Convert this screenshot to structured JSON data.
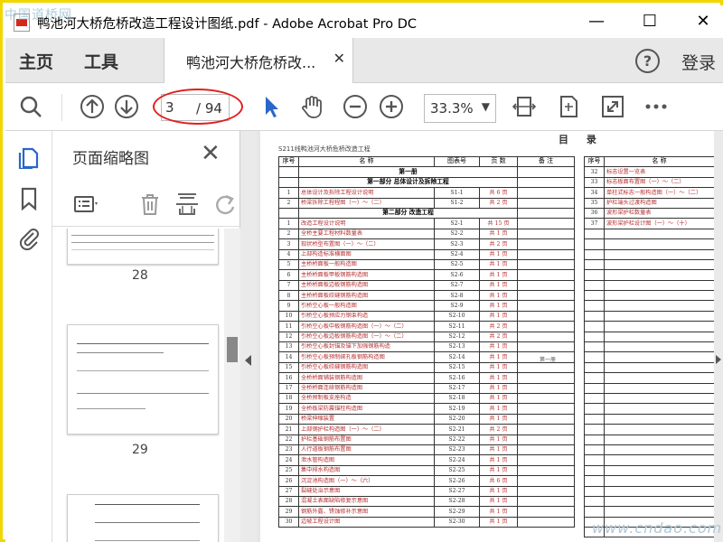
{
  "window": {
    "title": "鸭池河大桥危桥改造工程设计图纸.pdf - Adobe Acrobat Pro DC",
    "watermark_top": "中国道桥网",
    "watermark_bottom": "www.cndao.com"
  },
  "menu": {
    "home": "主页",
    "tools": "工具",
    "doc_tab": "鸭池河大桥危桥改...",
    "help": "?",
    "login": "登录"
  },
  "toolbar": {
    "current_page": "3",
    "total_pages": "/ 94",
    "zoom": "33.3%"
  },
  "thumbnail_panel": {
    "title": "页面缩略图",
    "pages": [
      "28",
      "29"
    ]
  },
  "document": {
    "heading": "S211线鸭池河大桥危桥改造工程",
    "toc_title": "目 录",
    "table_headers": [
      "序号",
      "名 称",
      "图表号",
      "页 数",
      "备 注"
    ],
    "volume_note": "第一册",
    "sections": [
      {
        "title": "第一册",
        "rows": []
      },
      {
        "title": "第一部分  总体设计及拆除工程",
        "rows": [
          [
            "1",
            "总体设计及拆除工程设计说明",
            "S1-1",
            "共 6 页"
          ],
          [
            "2",
            "桥梁拆除工程程图（一）～（二）",
            "S1-2",
            "共 2 页"
          ]
        ]
      },
      {
        "title": "第二部分  改造工程",
        "rows": [
          [
            "1",
            "改造工程设计说明",
            "S2-1",
            "共 15 页"
          ],
          [
            "2",
            "全桥主要工程材料数量表",
            "S2-2",
            "共 1 页"
          ],
          [
            "3",
            "现状桥型布置图（一）～（二）",
            "S2-3",
            "共 2 页"
          ],
          [
            "4",
            "上部构造标准横面图",
            "S2-4",
            "共 1 页"
          ],
          [
            "5",
            "主桥桥面板一般构造图",
            "S2-5",
            "共 1 页"
          ],
          [
            "6",
            "主桥桥面板甲板钢筋构造图",
            "S2-6",
            "共 1 页"
          ],
          [
            "7",
            "主桥桥面板边板钢筋构造图",
            "S2-7",
            "共 1 页"
          ],
          [
            "8",
            "主桥桥面板绞缝钢筋构造图",
            "S2-8",
            "共 1 页"
          ],
          [
            "9",
            "引桥空心板一般构造图",
            "S2-9",
            "共 1 页"
          ],
          [
            "10",
            "引桥空心板预应力钢束构造",
            "S2-10",
            "共 1 页"
          ],
          [
            "11",
            "引桥空心板中板钢筋构造图（一）～（二）",
            "S2-11",
            "共 2 页"
          ],
          [
            "12",
            "引桥空心板边板钢筋构造图（一）～（二）",
            "S2-12",
            "共 2 页"
          ],
          [
            "13",
            "引桥空心板封锚及锚下加强钢筋构造",
            "S2-13",
            "共 1 页"
          ],
          [
            "14",
            "引桥空心板预制绑孔板钢筋构造图",
            "S2-14",
            "共 1 页"
          ],
          [
            "15",
            "引桥空心板绞缝钢筋构造图",
            "S2-15",
            "共 1 页"
          ],
          [
            "16",
            "全桥桥面铺装钢筋构造图",
            "S2-16",
            "共 1 页"
          ],
          [
            "17",
            "全桥桥面连续钢筋构造图",
            "S2-17",
            "共 1 页"
          ],
          [
            "18",
            "全桥预制板支座构造",
            "S2-18",
            "共 1 页"
          ],
          [
            "19",
            "全桥板梁防震锚栓构造图",
            "S2-19",
            "共 1 页"
          ],
          [
            "20",
            "桥梁伸缩装置",
            "S2-20",
            "共 1 页"
          ],
          [
            "21",
            "上部钢护栏构造图（一）～（二）",
            "S2-21",
            "共 2 页"
          ],
          [
            "22",
            "护栏基础钢筋布置图",
            "S2-22",
            "共 1 页"
          ],
          [
            "23",
            "人行道板钢筋布置图",
            "S2-23",
            "共 1 页"
          ],
          [
            "24",
            "泄水管构造图",
            "S2-24",
            "共 1 页"
          ],
          [
            "25",
            "集中排水构造图",
            "S2-25",
            "共 1 页"
          ],
          [
            "26",
            "沉淀池构造图（一）～（六）",
            "S2-26",
            "共 6 页"
          ],
          [
            "27",
            "裂缝处治示意图",
            "S2-27",
            "共 1 页"
          ],
          [
            "28",
            "混凝土表面缺陷修复示意图",
            "S2-28",
            "共 1 页"
          ],
          [
            "29",
            "钢筋外露、锈蚀修补示意图",
            "S2-29",
            "共 1 页"
          ],
          [
            "30",
            "边坡工程设计图",
            "S2-30",
            "共 1 页"
          ]
        ]
      }
    ],
    "right_headers": [
      "序号",
      "名 称"
    ],
    "right_rows": [
      [
        "32",
        "标志设置一览表"
      ],
      [
        "33",
        "标志板面布置图（一）～（二）"
      ],
      [
        "34",
        "单柱式标志一般构造图（一）～（二）"
      ],
      [
        "35",
        "护栏端头过渡构造图"
      ],
      [
        "36",
        "波形梁护栏数量表"
      ],
      [
        "37",
        "波形梁护栏设计图（一）～（十）"
      ]
    ]
  }
}
